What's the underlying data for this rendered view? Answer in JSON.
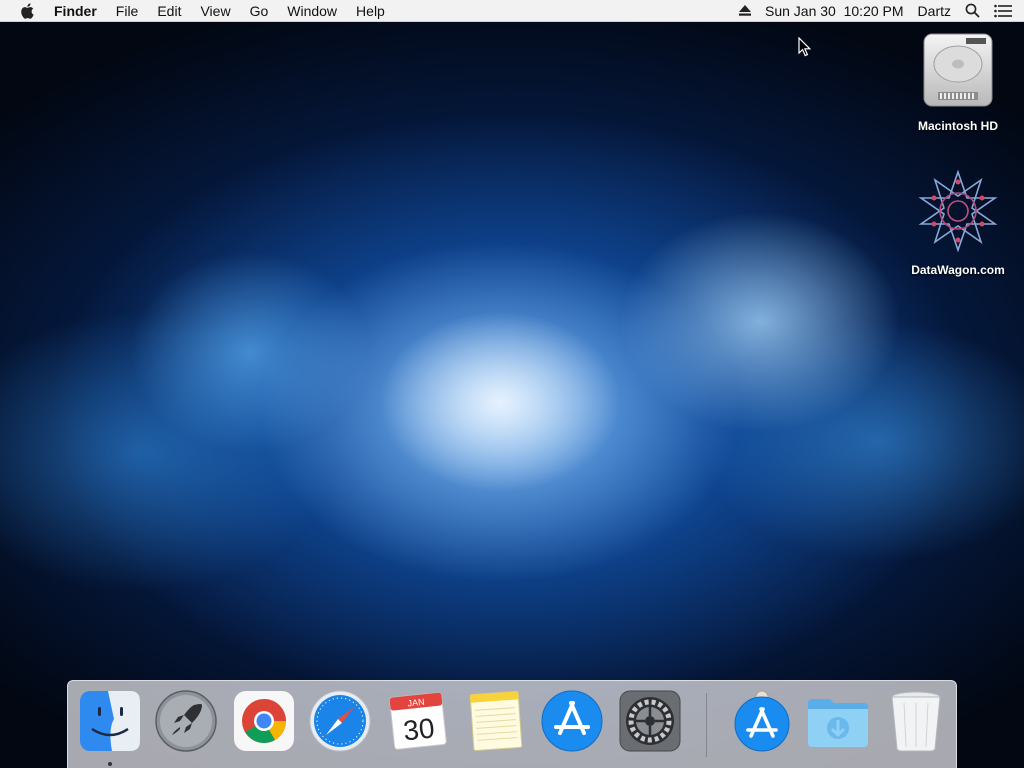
{
  "menubar": {
    "app_name": "Finder",
    "menus": [
      "File",
      "Edit",
      "View",
      "Go",
      "Window",
      "Help"
    ],
    "clock": "Sun Jan 30  10:20 PM",
    "user": "Dartz",
    "icons": [
      "apple-logo-icon",
      "eject-icon",
      "spotlight-search-icon",
      "notification-center-icon"
    ]
  },
  "desktop": {
    "icons": [
      {
        "label": "Macintosh HD",
        "icon": "hard-drive-icon"
      },
      {
        "label": "DataWagon.com",
        "icon": "datawagon-logo-icon"
      }
    ]
  },
  "dock": {
    "apps": [
      {
        "name": "Finder",
        "icon": "finder-icon",
        "running": true
      },
      {
        "name": "Launchpad",
        "icon": "launchpad-icon"
      },
      {
        "name": "Google Chrome",
        "icon": "chrome-icon"
      },
      {
        "name": "Safari",
        "icon": "safari-icon"
      },
      {
        "name": "Calendar",
        "icon": "calendar-icon",
        "month": "JAN",
        "day": "30"
      },
      {
        "name": "Notes",
        "icon": "notes-icon"
      },
      {
        "name": "App Store",
        "icon": "app-store-icon"
      },
      {
        "name": "System Preferences",
        "icon": "system-preferences-icon"
      },
      {
        "name": "App Store Installer",
        "icon": "app-store-installer-icon"
      },
      {
        "name": "Downloads",
        "icon": "downloads-folder-icon"
      },
      {
        "name": "Trash",
        "icon": "trash-icon"
      }
    ]
  },
  "colors": {
    "menubar_bg": "#f2f2f2",
    "wallpaper_accent": "#1e78d2",
    "app_store_blue": "#1a8cf0",
    "folder_blue": "#7ec4f0"
  }
}
